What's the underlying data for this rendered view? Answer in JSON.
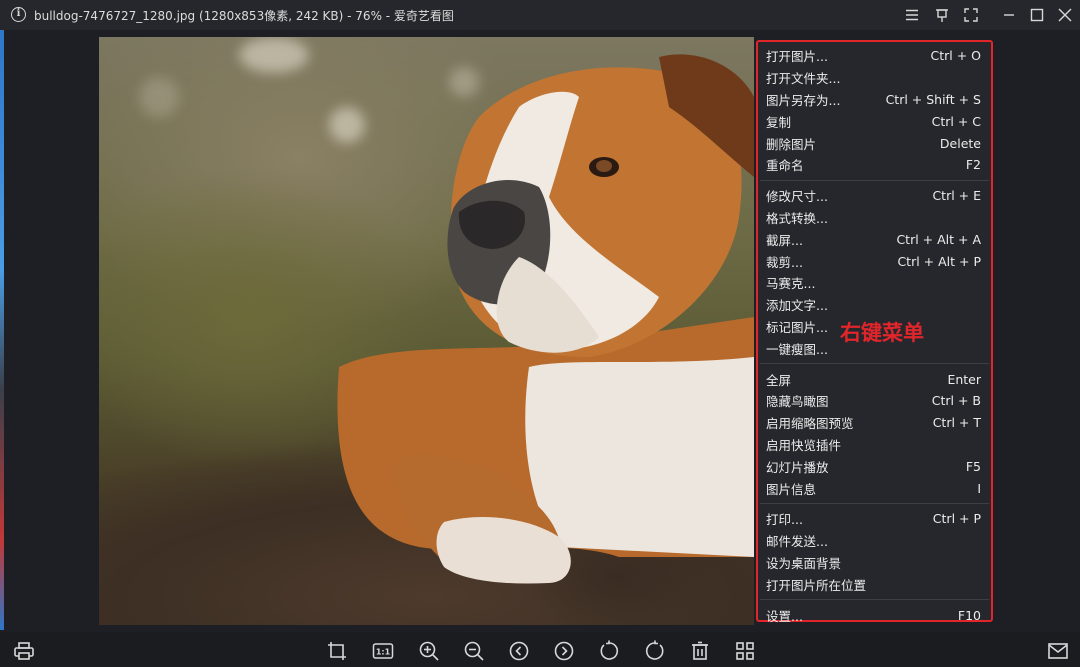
{
  "window": {
    "title": "bulldog-7476727_1280.jpg (1280x853像素, 242 KB) - 76% - 爱奇艺看图"
  },
  "title_icons": [
    "info-icon",
    "hamburger-menu-icon",
    "pin-icon",
    "fullscreen-icon",
    "minimize-icon",
    "maximize-icon",
    "close-icon"
  ],
  "context_menu": {
    "annotation": "右键菜单",
    "groups": [
      [
        {
          "label": "打开图片...",
          "shortcut": "Ctrl + O"
        },
        {
          "label": "打开文件夹...",
          "shortcut": ""
        },
        {
          "label": "图片另存为...",
          "shortcut": "Ctrl + Shift + S"
        },
        {
          "label": "复制",
          "shortcut": "Ctrl + C"
        },
        {
          "label": "删除图片",
          "shortcut": "Delete"
        },
        {
          "label": "重命名",
          "shortcut": "F2"
        }
      ],
      [
        {
          "label": "修改尺寸...",
          "shortcut": "Ctrl + E"
        },
        {
          "label": "格式转换...",
          "shortcut": ""
        },
        {
          "label": "截屏...",
          "shortcut": "Ctrl + Alt + A"
        },
        {
          "label": "裁剪...",
          "shortcut": "Ctrl + Alt + P"
        },
        {
          "label": "马赛克...",
          "shortcut": ""
        },
        {
          "label": "添加文字...",
          "shortcut": ""
        },
        {
          "label": "标记图片...",
          "shortcut": ""
        },
        {
          "label": "一键瘦图...",
          "shortcut": ""
        }
      ],
      [
        {
          "label": "全屏",
          "shortcut": "Enter"
        },
        {
          "label": "隐藏鸟瞰图",
          "shortcut": "Ctrl + B"
        },
        {
          "label": "启用缩略图预览",
          "shortcut": "Ctrl + T"
        },
        {
          "label": "启用快览插件",
          "shortcut": ""
        },
        {
          "label": "幻灯片播放",
          "shortcut": "F5"
        },
        {
          "label": "图片信息",
          "shortcut": "I"
        }
      ],
      [
        {
          "label": "打印...",
          "shortcut": "Ctrl + P"
        },
        {
          "label": "邮件发送...",
          "shortcut": ""
        },
        {
          "label": "设为桌面背景",
          "shortcut": ""
        },
        {
          "label": "打开图片所在位置",
          "shortcut": ""
        }
      ],
      [
        {
          "label": "设置...",
          "shortcut": "F10"
        }
      ]
    ]
  },
  "toolbar": {
    "buttons": [
      {
        "name": "print-button",
        "icon": "printer-icon"
      },
      {
        "name": "crop-button",
        "icon": "crop-icon"
      },
      {
        "name": "actual-size-button",
        "icon": "one-to-one-icon",
        "label": "1:1"
      },
      {
        "name": "zoom-in-button",
        "icon": "zoom-in-icon"
      },
      {
        "name": "zoom-out-button",
        "icon": "zoom-out-icon"
      },
      {
        "name": "previous-button",
        "icon": "chevron-left-icon"
      },
      {
        "name": "next-button",
        "icon": "chevron-right-icon"
      },
      {
        "name": "rotate-left-button",
        "icon": "rotate-left-icon"
      },
      {
        "name": "rotate-right-button",
        "icon": "rotate-right-icon"
      },
      {
        "name": "delete-button",
        "icon": "trash-icon"
      },
      {
        "name": "thumbnails-button",
        "icon": "grid-icon"
      },
      {
        "name": "mail-button",
        "icon": "mail-icon"
      }
    ]
  },
  "colors": {
    "window_bg": "#1e1f24",
    "menu_bg": "#26272c",
    "annotation_red": "#e0252b"
  }
}
